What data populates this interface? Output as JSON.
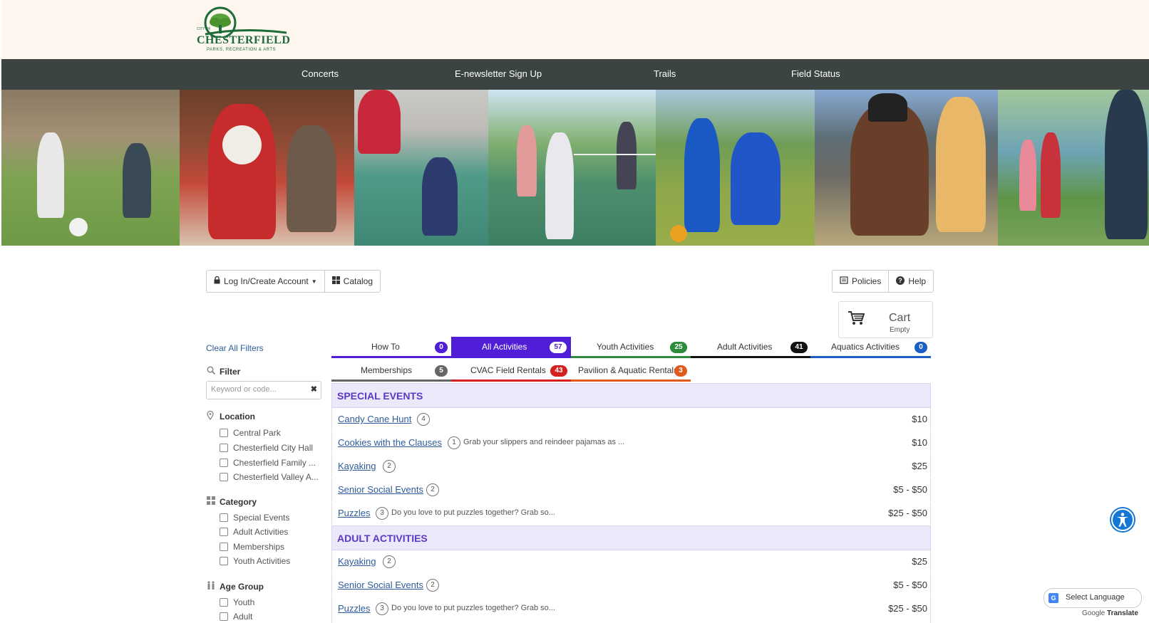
{
  "logo": {
    "top_text": "CITY OF",
    "name": "CHESTERFIELD",
    "subtitle": "PARKS, RECREATION & ARTS"
  },
  "nav": {
    "items": [
      "Concerts",
      "E-newsletter Sign Up",
      "Trails",
      "Field Status"
    ]
  },
  "toolbar": {
    "login_label": "Log In/Create Account",
    "catalog_label": "Catalog",
    "policies_label": "Policies",
    "help_label": "Help"
  },
  "cart": {
    "title": "Cart",
    "status": "Empty"
  },
  "filters": {
    "clear_label": "Clear All Filters",
    "filter_title": "Filter",
    "search_placeholder": "Keyword or code...",
    "location_title": "Location",
    "locations": [
      "Central Park",
      "Chesterfield City Hall",
      "Chesterfield Family ...",
      "Chesterfield Valley A..."
    ],
    "category_title": "Category",
    "categories": [
      "Special Events",
      "Adult Activities",
      "Memberships",
      "Youth Activities"
    ],
    "age_title": "Age Group",
    "ages": [
      "Youth",
      "Adult"
    ]
  },
  "tabs": {
    "row1": [
      {
        "label": "How To",
        "count": "0",
        "color": "#4f1ed6"
      },
      {
        "label": "All Activities",
        "count": "57",
        "color": "#4f1ed6"
      },
      {
        "label": "Youth Activities",
        "count": "25",
        "color": "#2e8b3a"
      },
      {
        "label": "Adult Activities",
        "count": "41",
        "color": "#111111"
      },
      {
        "label": "Aquatics Activities",
        "count": "0",
        "color": "#1a5fc4"
      }
    ],
    "row2": [
      {
        "label": "Memberships",
        "count": "5",
        "color": "#666666"
      },
      {
        "label": "CVAC Field Rentals",
        "count": "43",
        "color": "#d42020"
      },
      {
        "label": "Pavilion & Aquatic Rentals",
        "count": "3",
        "color": "#e05a1e"
      }
    ]
  },
  "sections": [
    {
      "title": "SPECIAL EVENTS",
      "items": [
        {
          "name": "Candy Cane Hunt",
          "count": "4",
          "desc": "",
          "price": "$10"
        },
        {
          "name": "Cookies with the Clauses",
          "count": "1",
          "desc": "Grab your slippers and reindeer pajamas as ...",
          "price": "$10"
        },
        {
          "name": "Kayaking",
          "count": "2",
          "desc": "",
          "price": "$25"
        },
        {
          "name": "Senior Social Events",
          "count": "2",
          "desc": "",
          "price": "$5 - $50"
        },
        {
          "name": "Puzzles",
          "count": "3",
          "desc": "Do you love to put puzzles together? Grab so...",
          "price": "$25 - $50"
        }
      ]
    },
    {
      "title": "ADULT ACTIVITIES",
      "items": [
        {
          "name": "Kayaking",
          "count": "2",
          "desc": "",
          "price": "$25"
        },
        {
          "name": "Senior Social Events",
          "count": "2",
          "desc": "",
          "price": "$5 - $50"
        },
        {
          "name": "Puzzles",
          "count": "3",
          "desc": "Do you love to put puzzles together? Grab so...",
          "price": "$25 - $50"
        }
      ]
    }
  ],
  "translate": {
    "label": "Select Language",
    "powered_prefix": "Google",
    "powered_suffix": "Translate"
  }
}
